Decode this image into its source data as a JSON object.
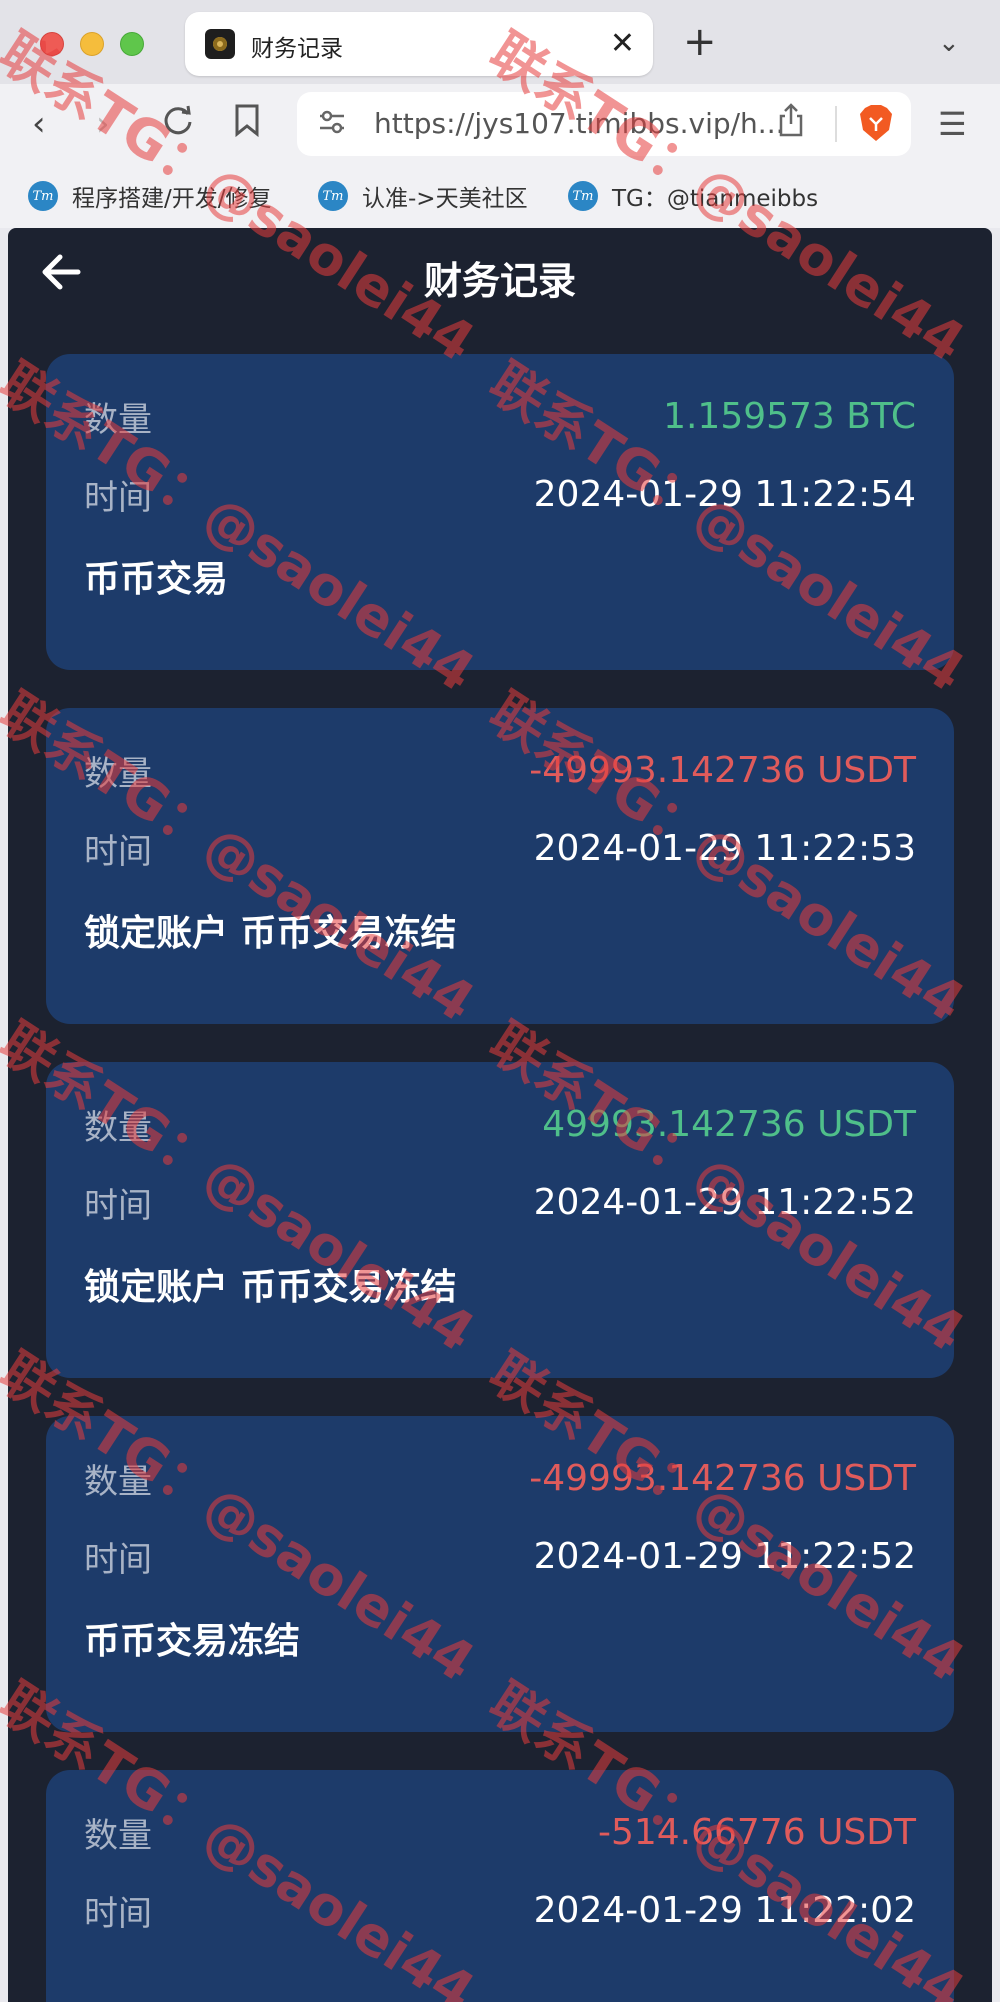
{
  "browser": {
    "tab_title": "财务记录",
    "url": "https://jys107.timibbs.vip/h...",
    "bookmarks": [
      {
        "label": "程序搭建/开发/修复",
        "icon": "tm-logo-icon"
      },
      {
        "label": "认准->天美社区",
        "icon": "tm-logo-icon"
      },
      {
        "label": "TG：@tianmeibbs",
        "icon": "tm-logo-icon"
      }
    ],
    "bookmark_icon_text": "Tm"
  },
  "page": {
    "title": "财务记录",
    "records": [
      {
        "amount_label": "数量",
        "amount": "1.159573 BTC",
        "direction": "positive",
        "time_label": "时间",
        "time": "2024-01-29 11:22:54",
        "note": "币币交易"
      },
      {
        "amount_label": "数量",
        "amount": "-49993.142736 USDT",
        "direction": "negative",
        "time_label": "时间",
        "time": "2024-01-29 11:22:53",
        "note": "锁定账户 币币交易冻结"
      },
      {
        "amount_label": "数量",
        "amount": "49993.142736 USDT",
        "direction": "positive",
        "time_label": "时间",
        "time": "2024-01-29 11:22:52",
        "note": "锁定账户 币币交易冻结"
      },
      {
        "amount_label": "数量",
        "amount": "-49993.142736 USDT",
        "direction": "negative",
        "time_label": "时间",
        "time": "2024-01-29 11:22:52",
        "note": "币币交易冻结"
      },
      {
        "amount_label": "数量",
        "amount": "-514.66776 USDT",
        "direction": "negative",
        "time_label": "时间",
        "time": "2024-01-29 11:22:02",
        "note": ""
      }
    ]
  },
  "watermark": {
    "text": "联系TG：@saolei44"
  },
  "colors": {
    "page_bg": "#1c2230",
    "card_bg": "#1d3b6a",
    "positive": "#4fbf8a",
    "negative": "#e05b5b",
    "watermark": "#e63c3c"
  }
}
